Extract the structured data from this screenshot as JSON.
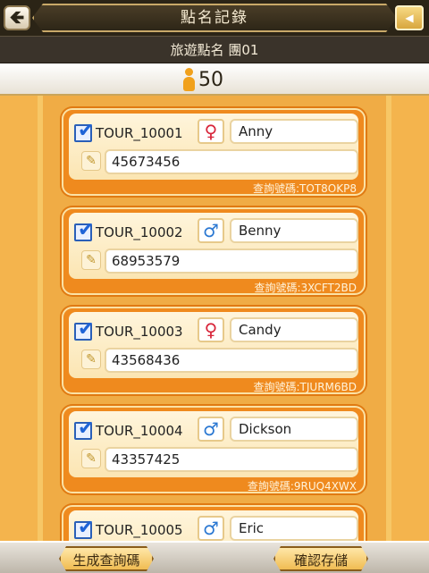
{
  "header": {
    "title": "點名記錄",
    "back_label": "🡸",
    "menu_label": "◀"
  },
  "subheader": {
    "title": "旅遊點名 團01"
  },
  "summary": {
    "count": "50",
    "icon": "person-icon"
  },
  "records": [
    {
      "tour_id": "TOUR_10001",
      "gender": "female",
      "gender_symbol": "♀",
      "name": "Anny",
      "phone": "45673456",
      "query_code": "查詢號碼:TOT8OKP8",
      "checked": true
    },
    {
      "tour_id": "TOUR_10002",
      "gender": "male",
      "gender_symbol": "♂",
      "name": "Benny",
      "phone": "68953579",
      "query_code": "查詢號碼:3XCFT2BD",
      "checked": true
    },
    {
      "tour_id": "TOUR_10003",
      "gender": "female",
      "gender_symbol": "♀",
      "name": "Candy",
      "phone": "43568436",
      "query_code": "查詢號碼:TJURM6BD",
      "checked": true
    },
    {
      "tour_id": "TOUR_10004",
      "gender": "male",
      "gender_symbol": "♂",
      "name": "Dickson",
      "phone": "43357425",
      "query_code": "查詢號碼:9RUQ4XWX",
      "checked": true
    },
    {
      "tour_id": "TOUR_10005",
      "gender": "male",
      "gender_symbol": "♂",
      "name": "Eric",
      "phone": "",
      "query_code": "",
      "checked": true
    }
  ],
  "footer": {
    "generate_label": "生成查詢碼",
    "save_label": "確認存儲"
  },
  "colors": {
    "accent": "#ef8a1e",
    "background": "#f3b24c",
    "female": "#d8263b",
    "male": "#2b78d2"
  }
}
